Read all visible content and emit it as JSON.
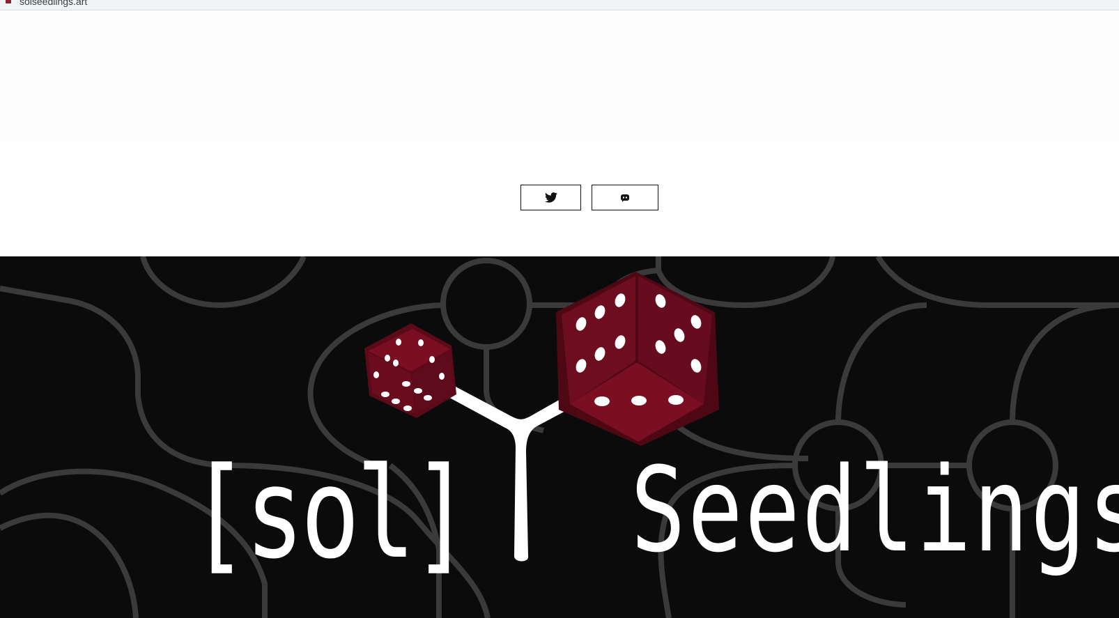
{
  "browser": {
    "tab_title": "solseedlings.art"
  },
  "social": {
    "twitter_icon": "twitter-bird-icon",
    "discord_icon": "discord-icon"
  },
  "banner": {
    "title_left": "[sol]",
    "title_right": "Seedlings",
    "colors": {
      "background": "#0b0b0b",
      "pattern": "#3a3a3a",
      "dice": "#7a0e22",
      "pips": "#ffffff"
    }
  }
}
